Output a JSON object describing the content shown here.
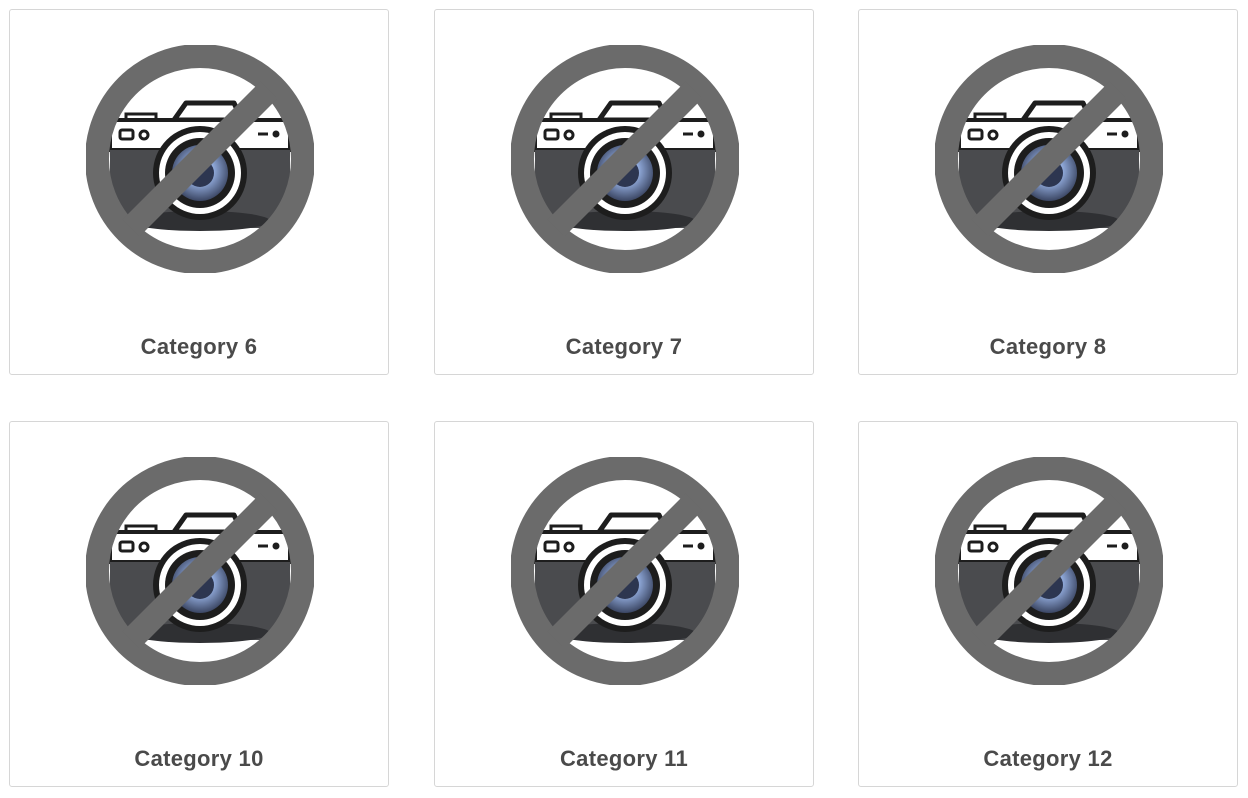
{
  "category_grid": {
    "cards": [
      {
        "label": "Category 6",
        "image": "no-image-camera-icon"
      },
      {
        "label": "Category 7",
        "image": "no-image-camera-icon"
      },
      {
        "label": "Category 8",
        "image": "no-image-camera-icon"
      },
      {
        "label": "Category 10",
        "image": "no-image-camera-icon"
      },
      {
        "label": "Category 11",
        "image": "no-image-camera-icon"
      },
      {
        "label": "Category 12",
        "image": "no-image-camera-icon"
      }
    ]
  },
  "colors": {
    "card_border": "#d6d6d6",
    "label_text": "#4a4a4a",
    "prohibit_sign": "#6b6b6b",
    "camera_body_dark": "#4a4b4e",
    "lens_blue": "#8fa8d8"
  }
}
